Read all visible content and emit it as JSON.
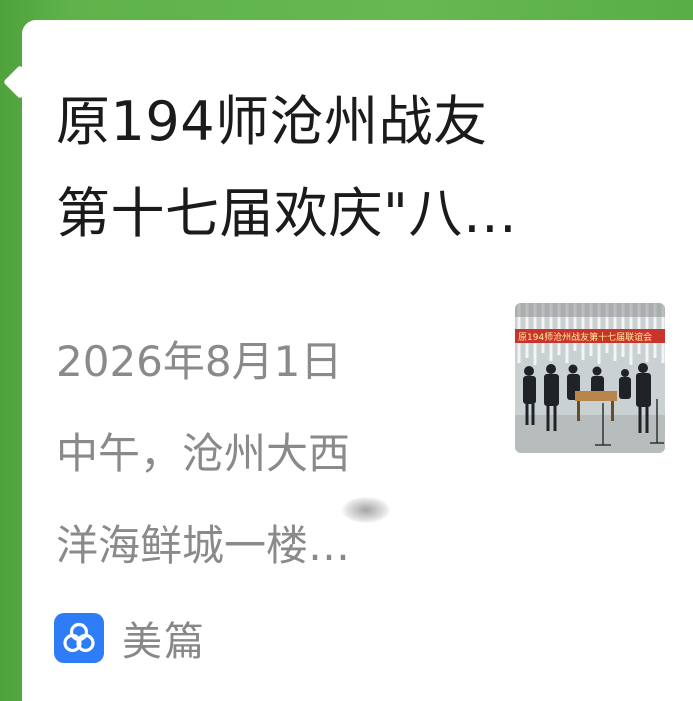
{
  "card": {
    "title_lines": [
      "原194师沧州战友",
      "第十七届欢庆\"八…"
    ],
    "description_lines": [
      "2026年8月1日",
      "中午，沧州大西",
      "洋海鲜城一楼…"
    ],
    "thumbnail_banner_text": "原194师沧州战友第十七届联谊会",
    "source": {
      "app_name": "美篇",
      "icon": "meipian-logo-icon"
    }
  },
  "colors": {
    "background_green": "#5cae45",
    "card_bg": "#ffffff",
    "title": "#1b1b1b",
    "description": "#8a8a8a",
    "source_icon_bg": "#2f7df6"
  }
}
